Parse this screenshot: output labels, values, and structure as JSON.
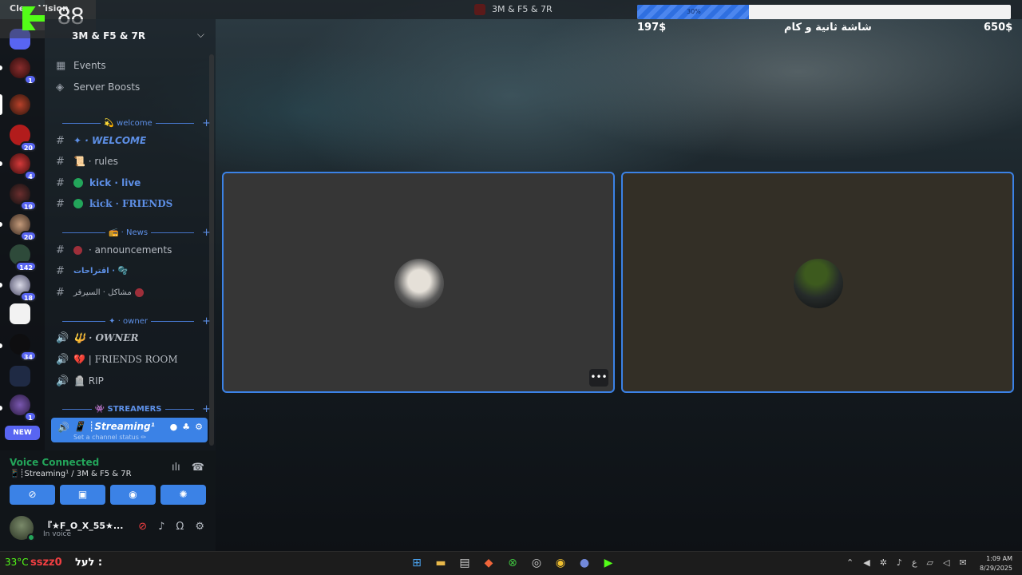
{
  "overlay": {
    "app_name": "Clear Vision",
    "viewer_count": "88"
  },
  "window": {
    "title": "3M & F5 & 7R"
  },
  "goal": {
    "progress_percent": 30,
    "progress_label": "30%",
    "current": "197$",
    "title": "شاشة ثانية و كام",
    "target": "650$"
  },
  "server": {
    "name": "3M & F5 & 7R",
    "top_items": [
      {
        "icon": "calendar-icon",
        "label": "Events"
      },
      {
        "icon": "boost-icon",
        "label": "Server Boosts"
      }
    ],
    "categories": {
      "welcome": "💫 welcome",
      "news": "📻 · News",
      "owner": "✦ · owner",
      "streamers": "👾 STREAMERS"
    },
    "channels": {
      "welcome": "✦ · WELCOME",
      "rules": "📜 · rules",
      "kick_live": "kick · live",
      "kick_friends": "kick · FRIENDS",
      "announcements": "· announcements",
      "suggestions": "اقتراحات · 🫧",
      "problems": "مشاكل · السيرفر",
      "owner": "🔱 · OWNER",
      "friends_room": "💔 | FRIENDS ROOM",
      "rip": "🪦 RIP",
      "streaming": "📱 ┊Streaming¹",
      "streaming_sub": "Set a channel status ✏"
    }
  },
  "rail": {
    "badges": [
      "1",
      "20",
      "4",
      "19",
      "20",
      "142",
      "18",
      "34",
      "1",
      "207"
    ],
    "new_label": "NEW"
  },
  "voice": {
    "status": "Voice Connected",
    "channel": "📱┊Streaming¹ / 3M & F5 & 7R",
    "user_name": "『★F_O_X_55★...",
    "user_status": "In voice"
  },
  "taskbar": {
    "weather": "33°C",
    "ticker_red": "sszz0",
    "ticker_white": "לעל :",
    "time": "1:09 AM",
    "date": "8/29/2025"
  }
}
